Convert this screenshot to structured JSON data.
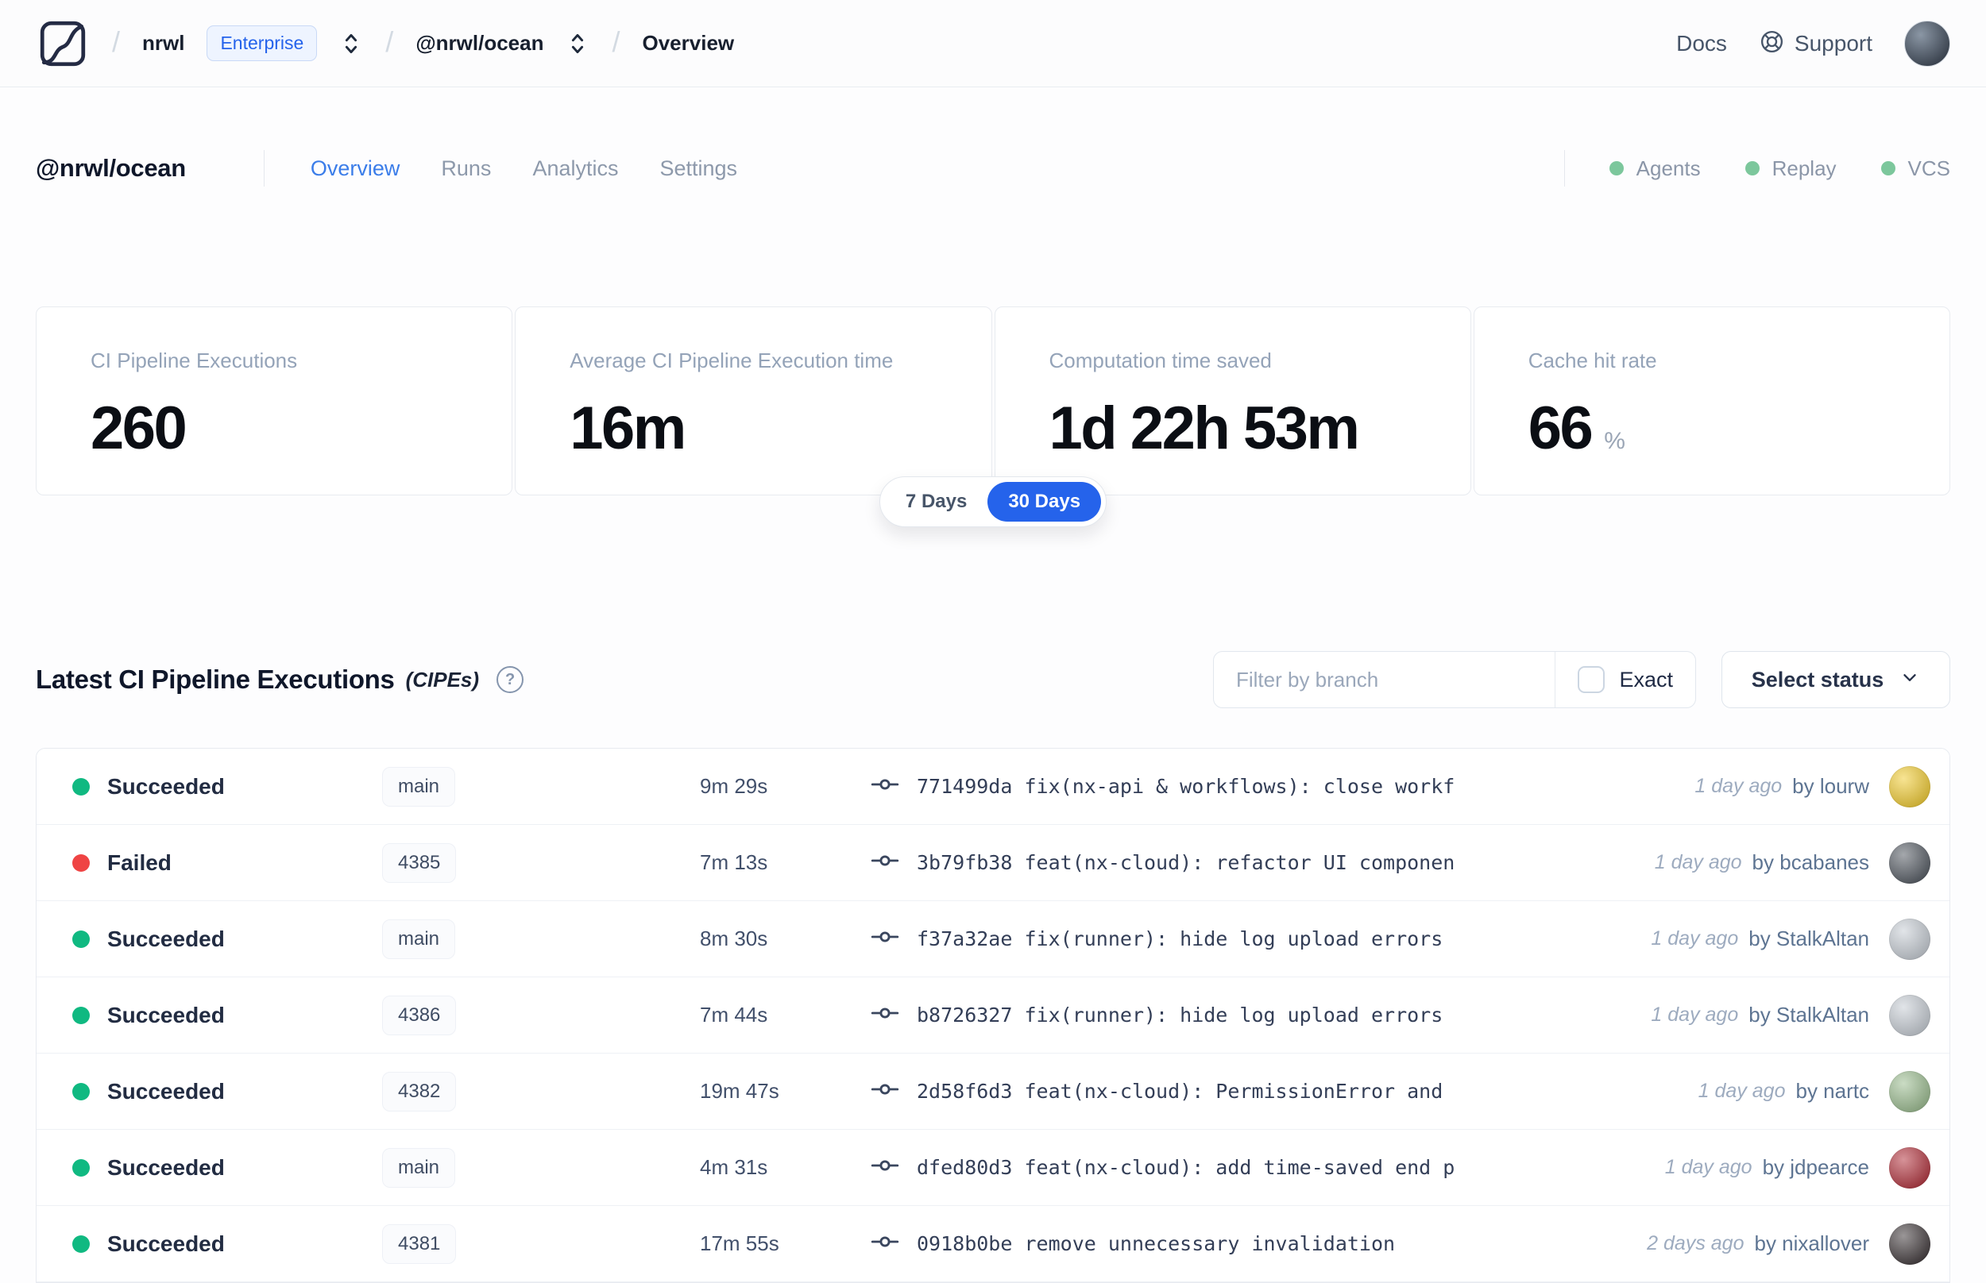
{
  "topbar": {
    "org": "nrwl",
    "org_badge": "Enterprise",
    "workspace": "@nrwl/ocean",
    "page": "Overview",
    "docs_label": "Docs",
    "support_label": "Support"
  },
  "header": {
    "title": "@nrwl/ocean",
    "tabs": [
      {
        "label": "Overview",
        "active": true
      },
      {
        "label": "Runs",
        "active": false
      },
      {
        "label": "Analytics",
        "active": false
      },
      {
        "label": "Settings",
        "active": false
      }
    ],
    "statuses": [
      {
        "label": "Agents",
        "color": "#7cc79c"
      },
      {
        "label": "Replay",
        "color": "#7cc79c"
      },
      {
        "label": "VCS",
        "color": "#7cc79c"
      }
    ]
  },
  "stats": {
    "cards": [
      {
        "label": "CI Pipeline Executions",
        "value": "260",
        "suffix": ""
      },
      {
        "label": "Average CI Pipeline Execution time",
        "value": "16m",
        "suffix": ""
      },
      {
        "label": "Computation time saved",
        "value": "1d 22h 53m",
        "suffix": ""
      },
      {
        "label": "Cache hit rate",
        "value": "66",
        "suffix": "%"
      }
    ],
    "range_toggle": {
      "options": [
        "7 Days",
        "30 Days"
      ],
      "selected": "30 Days",
      "selected_color": "#2563eb"
    }
  },
  "cipe": {
    "title": "Latest CI Pipeline Executions",
    "title_note": "(CIPEs)",
    "help_glyph": "?",
    "filter_placeholder": "Filter by branch",
    "exact_label": "Exact",
    "exact_checked": false,
    "status_dropdown_label": "Select status",
    "rows": [
      {
        "status": "Succeeded",
        "status_color": "#10b981",
        "branch": "main",
        "duration": "9m 29s",
        "commit_hash": "771499da",
        "commit_message": "fix(nx-api & workflows): close workfl…",
        "time_ago": "1 day ago",
        "author": "by lourw",
        "avatar_color": "#f2ce3a"
      },
      {
        "status": "Failed",
        "status_color": "#ef4444",
        "branch": "4385",
        "duration": "7m 13s",
        "commit_hash": "3b79fb38",
        "commit_message": "feat(nx-cloud): refactor UI component…",
        "time_ago": "1 day ago",
        "author": "by bcabanes",
        "avatar_color": "#5a6068"
      },
      {
        "status": "Succeeded",
        "status_color": "#10b981",
        "branch": "main",
        "duration": "8m 30s",
        "commit_hash": "f37a32ae",
        "commit_message": "fix(runner): hide log upload errors b…",
        "time_ago": "1 day ago",
        "author": "by StalkAltan",
        "avatar_color": "#c9cfd6"
      },
      {
        "status": "Succeeded",
        "status_color": "#10b981",
        "branch": "4386",
        "duration": "7m 44s",
        "commit_hash": "b8726327",
        "commit_message": "fix(runner): hide log upload errors b…",
        "time_ago": "1 day ago",
        "author": "by StalkAltan",
        "avatar_color": "#c9cfd6"
      },
      {
        "status": "Succeeded",
        "status_color": "#10b981",
        "branch": "4382",
        "duration": "19m 47s",
        "commit_hash": "2d58f6d3",
        "commit_message": "feat(nx-cloud): PermissionError and N…",
        "time_ago": "1 day ago",
        "author": "by nartc",
        "avatar_color": "#9fbf94"
      },
      {
        "status": "Succeeded",
        "status_color": "#10b981",
        "branch": "main",
        "duration": "4m 31s",
        "commit_hash": "dfed80d3",
        "commit_message": "feat(nx-cloud): add time-saved end po…",
        "time_ago": "1 day ago",
        "author": "by jdpearce",
        "avatar_color": "#b53a44"
      },
      {
        "status": "Succeeded",
        "status_color": "#10b981",
        "branch": "4381",
        "duration": "17m 55s",
        "commit_hash": "0918b0be",
        "commit_message": "remove unnecessary invalidation",
        "time_ago": "2 days ago",
        "author": "by nixallover",
        "avatar_color": "#474042"
      }
    ]
  }
}
